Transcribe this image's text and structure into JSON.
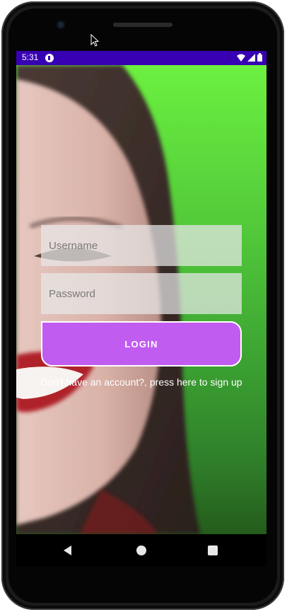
{
  "status_bar": {
    "time": "5:31",
    "icons": [
      "app-notification-icon",
      "wifi-icon",
      "signal-icon",
      "battery-icon"
    ],
    "color": "#3700b3"
  },
  "login_form": {
    "username_placeholder": "Username",
    "password_placeholder": "Password",
    "login_label": "LOGIN",
    "login_color": "#c15cf0"
  },
  "signup_link": "Don't have an account?, press here to sign up",
  "nav_bar": {
    "icons": [
      "back-icon",
      "home-icon",
      "recents-icon"
    ]
  },
  "background": {
    "gradient_top": "#6cf040",
    "gradient_bottom": "#245c1c"
  }
}
